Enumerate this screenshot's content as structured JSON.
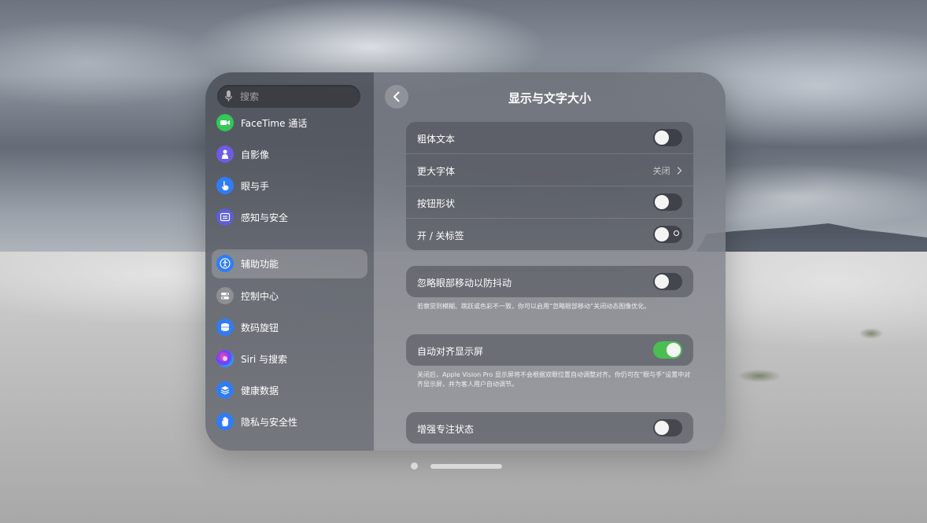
{
  "sidebar": {
    "search": {
      "placeholder": "搜索",
      "icon": "microphone-icon"
    },
    "items": [
      {
        "label": "FaceTime 通话",
        "icon": "video-camera-icon",
        "color": "#34c759"
      },
      {
        "label": "自影像",
        "icon": "persona-icon",
        "color": "#6e5ce6"
      },
      {
        "label": "眼与手",
        "icon": "hand-pointing-icon",
        "color": "#2f7cf6"
      },
      {
        "label": "感知与安全",
        "icon": "safety-icon",
        "color": "#5b5fd6"
      },
      {
        "label": "辅助功能",
        "icon": "accessibility-icon",
        "color": "#2f7cf6",
        "active": true
      },
      {
        "label": "控制中心",
        "icon": "control-center-icon",
        "color": "#8e8e93"
      },
      {
        "label": "数码旋钮",
        "icon": "digital-crown-icon",
        "color": "#2f7cf6"
      },
      {
        "label": "Siri 与搜索",
        "icon": "siri-icon",
        "color": "#1c1c1e"
      },
      {
        "label": "健康数据",
        "icon": "health-stack-icon",
        "color": "#2f7cf6"
      },
      {
        "label": "隐私与安全性",
        "icon": "privacy-hand-icon",
        "color": "#2f7cf6"
      }
    ]
  },
  "main": {
    "title": "显示与文字大小",
    "back_icon": "chevron-left-icon",
    "group1": [
      {
        "label": "粗体文本",
        "type": "toggle",
        "on": false
      },
      {
        "label": "更大字体",
        "type": "link",
        "value": "关闭"
      },
      {
        "label": "按钮形状",
        "type": "toggle",
        "on": false
      },
      {
        "label": "开 / 关标签",
        "type": "toggle",
        "on": false
      }
    ],
    "group2": {
      "label": "忽略眼部移动以防抖动",
      "on": false,
      "note": "若察觉到模糊、跳跃或色彩不一致，你可以启用“忽略眼部移动”关闭动态图像优化。"
    },
    "group3": {
      "label": "自动对齐显示屏",
      "on": true,
      "note": "关闭后，Apple Vision Pro 显示屏将不会根据双眼位置自动调整对齐。你仍可在“眼与手”设置中对齐显示屏，并为客人用户自动调节。"
    },
    "group4": {
      "label": "增强专注状态",
      "on": false
    }
  },
  "colors": {
    "toggle_on": "#4cbd52"
  }
}
